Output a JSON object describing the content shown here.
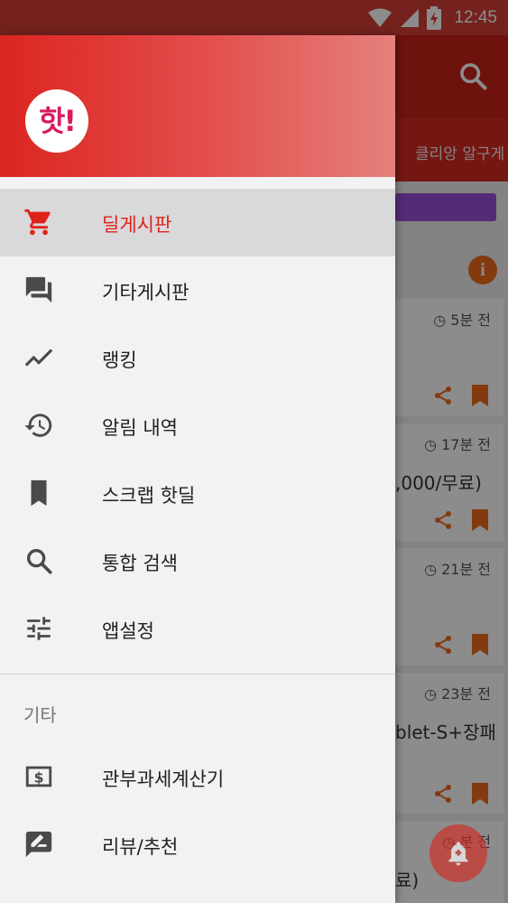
{
  "status_bar": {
    "time": "12:45"
  },
  "background": {
    "tab_label": "클리앙 알구게",
    "info_icon": "i",
    "cards": [
      {
        "time": "◷ 5분 전",
        "title": ""
      },
      {
        "time": "◷ 17분 전",
        "title": ",000/무료)"
      },
      {
        "time": "◷ 21분 전",
        "title": ""
      },
      {
        "time": "◷ 23분 전",
        "title": "blet-S+장패"
      },
      {
        "time": "◷ 분 전",
        "title": "료)"
      }
    ]
  },
  "drawer": {
    "logo_text": "핫!",
    "menu": [
      {
        "label": "딜게시판",
        "icon": "shopping-cart-icon",
        "active": true
      },
      {
        "label": "기타게시판",
        "icon": "forum-icon"
      },
      {
        "label": "랭킹",
        "icon": "trending-icon"
      },
      {
        "label": "알림 내역",
        "icon": "history-icon"
      },
      {
        "label": "스크랩 핫딜",
        "icon": "bookmark-icon"
      },
      {
        "label": "통합 검색",
        "icon": "search-icon"
      },
      {
        "label": "앱설정",
        "icon": "tune-icon"
      }
    ],
    "section_label": "기타",
    "extra_menu": [
      {
        "label": "관부과세계산기",
        "icon": "calculator-icon"
      },
      {
        "label": "리뷰/추천",
        "icon": "rate-review-icon"
      }
    ]
  },
  "colors": {
    "accent": "#e0231a",
    "header_start": "#dc2520",
    "header_end": "#e5807c",
    "icon": "#4a4a4a"
  }
}
